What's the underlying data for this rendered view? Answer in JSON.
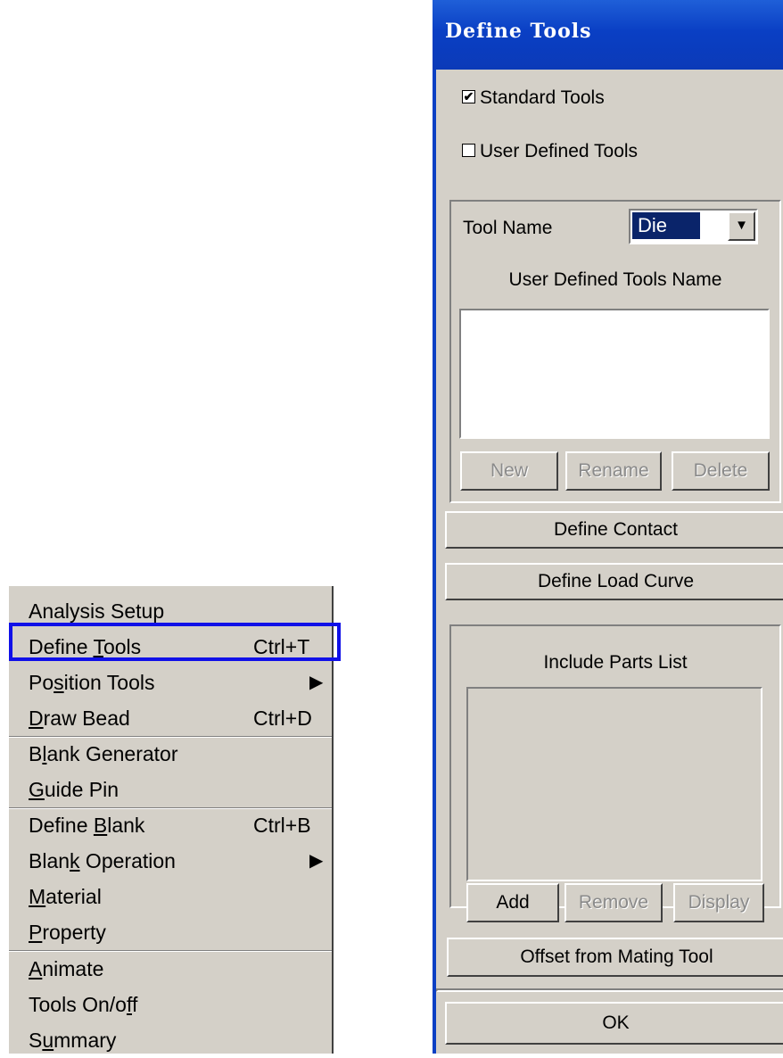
{
  "menu": {
    "items": [
      {
        "pre": "",
        "ul": "",
        "post": "Analysis Setup",
        "shortcut": "",
        "arrow": ""
      },
      {
        "pre": "Define ",
        "ul": "T",
        "post": "ools",
        "shortcut": "Ctrl+T",
        "arrow": ""
      },
      {
        "pre": "Po",
        "ul": "s",
        "post": "ition Tools",
        "shortcut": "",
        "arrow": "▶"
      },
      {
        "pre": "",
        "ul": "D",
        "post": "raw Bead",
        "shortcut": "Ctrl+D",
        "arrow": ""
      },
      {
        "pre": "B",
        "ul": "l",
        "post": "ank Generator",
        "shortcut": "",
        "arrow": ""
      },
      {
        "pre": "",
        "ul": "G",
        "post": "uide Pin",
        "shortcut": "",
        "arrow": ""
      },
      {
        "pre": "Define ",
        "ul": "B",
        "post": "lank",
        "shortcut": "Ctrl+B",
        "arrow": ""
      },
      {
        "pre": "Blan",
        "ul": "k",
        "post": " Operation",
        "shortcut": "",
        "arrow": "▶"
      },
      {
        "pre": "",
        "ul": "M",
        "post": "aterial",
        "shortcut": "",
        "arrow": ""
      },
      {
        "pre": "",
        "ul": "P",
        "post": "roperty",
        "shortcut": "",
        "arrow": ""
      },
      {
        "pre": "",
        "ul": "A",
        "post": "nimate",
        "shortcut": "",
        "arrow": ""
      },
      {
        "pre": "Tools On/o",
        "ul": "f",
        "post": "f",
        "shortcut": "",
        "arrow": ""
      },
      {
        "pre": "S",
        "ul": "u",
        "post": "mmary",
        "shortcut": "",
        "arrow": ""
      }
    ]
  },
  "dialog": {
    "title": "Define Tools",
    "standard_tools": {
      "label": "Standard Tools",
      "checked": true,
      "mark": "✔"
    },
    "user_defined_tools": {
      "label": "User Defined Tools",
      "checked": false,
      "mark": ""
    },
    "tool_name_label": "Tool Name",
    "tool_name_value": "Die",
    "dropdown_arrow": "▼",
    "user_tools_name_label": "User Defined Tools Name",
    "new_button": "New",
    "rename_button": "Rename",
    "delete_button": "Delete",
    "define_contact_button": "Define Contact",
    "define_load_curve_button": "Define Load Curve",
    "include_parts_label": "Include Parts List",
    "add_button": "Add",
    "remove_button": "Remove",
    "display_button": "Display",
    "offset_button": "Offset from Mating Tool",
    "ok_button": "OK"
  },
  "colors": {
    "title_bar": "#0a3fc4",
    "highlight_box": "#1010e8",
    "face": "#d4d0c8",
    "selection": "#0a246a"
  }
}
